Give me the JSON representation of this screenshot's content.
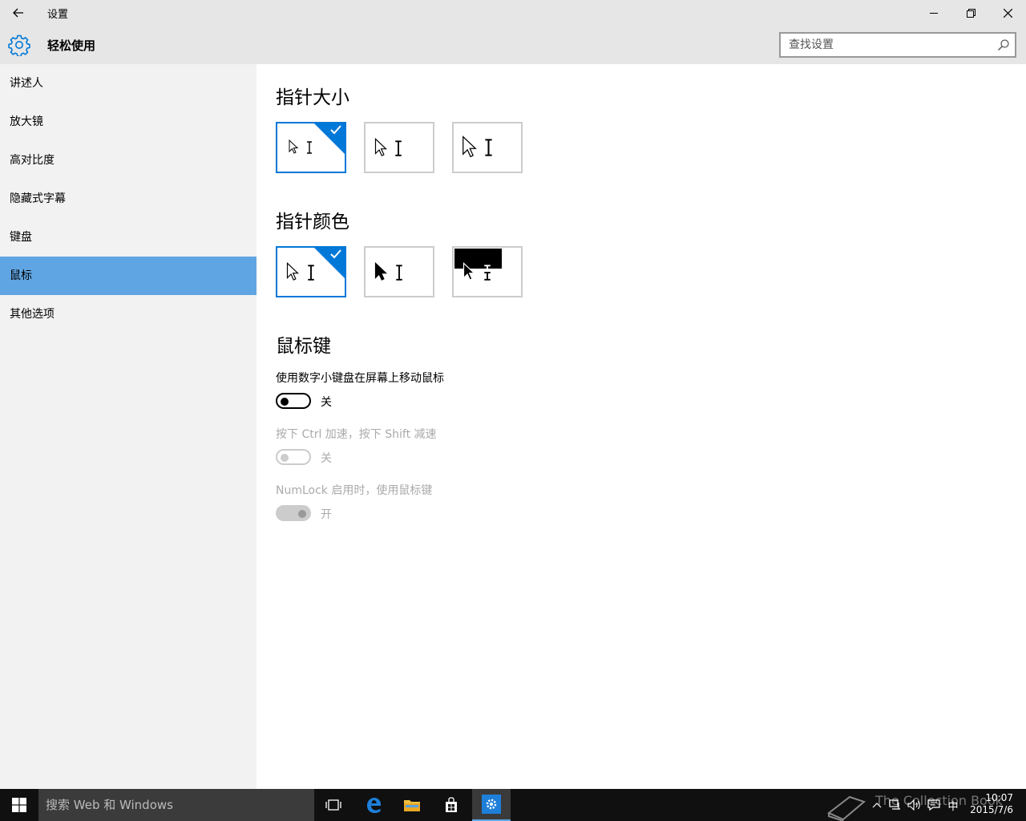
{
  "window": {
    "title": "设置",
    "back_icon": "back-arrow-icon",
    "controls": [
      "minimize",
      "restore",
      "close"
    ]
  },
  "header": {
    "heading": "轻松使用",
    "icon": "gear-icon",
    "search_placeholder": "查找设置"
  },
  "sidebar": {
    "items": [
      {
        "label": "讲述人"
      },
      {
        "label": "放大镜"
      },
      {
        "label": "高对比度"
      },
      {
        "label": "隐藏式字幕"
      },
      {
        "label": "键盘"
      },
      {
        "label": "鼠标",
        "active": true
      },
      {
        "label": "其他选项"
      }
    ]
  },
  "main": {
    "pointer_size": {
      "heading": "指针大小",
      "options": [
        "small",
        "medium",
        "large"
      ],
      "selected_index": 0
    },
    "pointer_color": {
      "heading": "指针颜色",
      "options": [
        "white",
        "black",
        "inverted"
      ],
      "selected_index": 0
    },
    "mouse_keys": {
      "heading": "鼠标键",
      "setting1": {
        "label": "使用数字小键盘在屏幕上移动鼠标",
        "state": "关",
        "on": false,
        "enabled": true
      },
      "setting2": {
        "label": "按下 Ctrl 加速，按下 Shift 减速",
        "state": "关",
        "on": false,
        "enabled": false
      },
      "setting3": {
        "label": "NumLock 启用时，使用鼠标键",
        "state": "开",
        "on": true,
        "enabled": false
      }
    }
  },
  "taskbar": {
    "search_text": "搜索 Web 和 Windows",
    "apps": [
      "task-view",
      "edge",
      "file-explorer",
      "store",
      "settings"
    ],
    "active_app": "settings",
    "ime": "中",
    "time": "10:07",
    "date": "2015/7/6",
    "watermark": "The Collection Book"
  },
  "colors": {
    "accent": "#0078d7",
    "nav_active": "#60a5e3",
    "chrome": "#e6e6e6",
    "sidebar": "#f2f2f2",
    "taskbar": "#101010"
  }
}
